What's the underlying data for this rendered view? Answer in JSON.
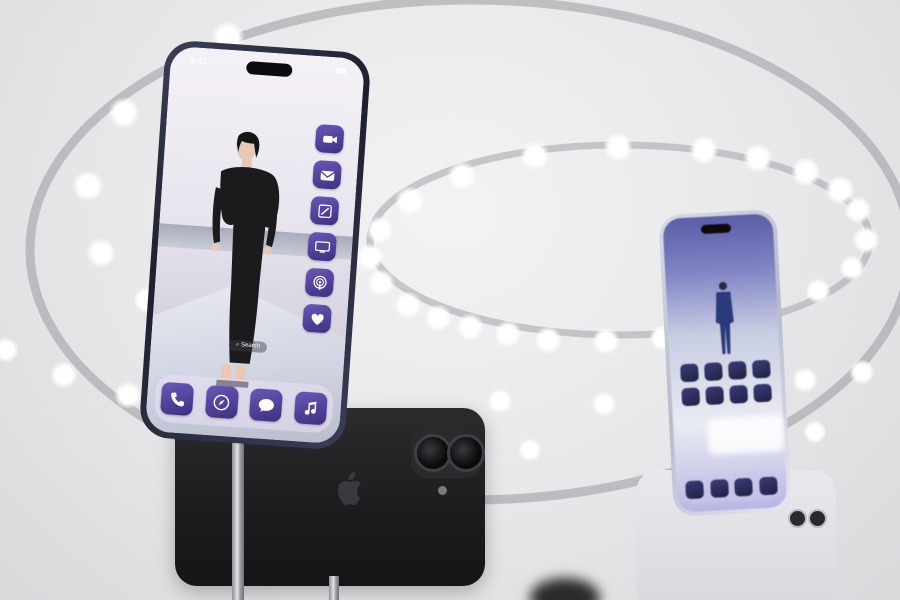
{
  "main_phone": {
    "status_time": "9:41",
    "status_battery": "▮▮▮",
    "search_label": "Search",
    "side_apps": [
      "video-camera-icon",
      "mail-icon",
      "notes-icon",
      "tv-icon",
      "podcasts-icon",
      "health-heart-icon"
    ],
    "dock_apps": [
      "phone-icon",
      "safari-compass-icon",
      "messages-icon",
      "music-icon"
    ],
    "accent_color": "#4b3c98"
  },
  "right_phone": {
    "accent_color": "#3b3c78"
  },
  "back_phone": {
    "color": "#1c1c1f"
  }
}
